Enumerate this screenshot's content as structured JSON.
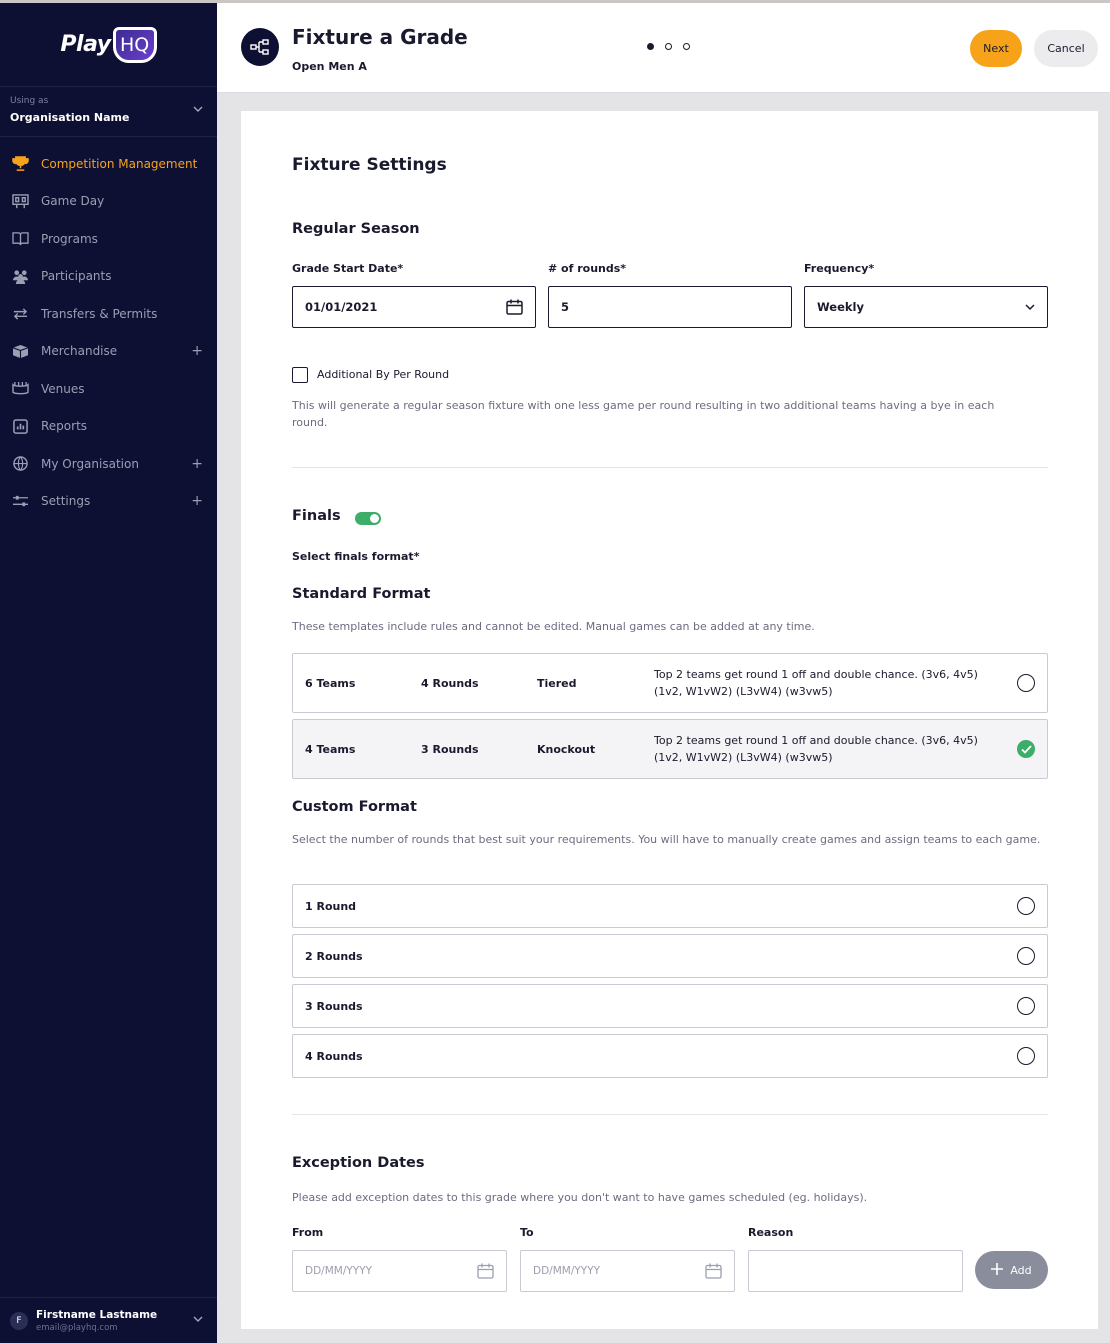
{
  "brand": {
    "logo_text": "Play",
    "logo_badge": "HQ",
    "accent": "#f6a31a",
    "sidebar_bg": "#0e1033",
    "success": "#3dae6a"
  },
  "org": {
    "label": "Using as",
    "name": "Organisation Name"
  },
  "nav": [
    {
      "label": "Competition Management",
      "icon": "trophy-icon",
      "active": true
    },
    {
      "label": "Game Day",
      "icon": "scoreboard-icon"
    },
    {
      "label": "Programs",
      "icon": "book-icon"
    },
    {
      "label": "Participants",
      "icon": "people-icon"
    },
    {
      "label": "Transfers & Permits",
      "icon": "transfer-arrows-icon"
    },
    {
      "label": "Merchandise",
      "icon": "box-icon",
      "expand": "+"
    },
    {
      "label": "Venues",
      "icon": "stadium-icon"
    },
    {
      "label": "Reports",
      "icon": "report-icon"
    },
    {
      "label": "My Organisation",
      "icon": "globe-icon",
      "expand": "+"
    },
    {
      "label": "Settings",
      "icon": "sliders-icon",
      "expand": "+"
    }
  ],
  "user": {
    "initial": "F",
    "name": "Firstname Lastname",
    "email": "email@playhq.com"
  },
  "header": {
    "title": "Fixture a Grade",
    "subtitle": "Open Men A",
    "step_current": 1,
    "step_total": 3,
    "next_label": "Next",
    "cancel_label": "Cancel"
  },
  "fixture_settings": {
    "title": "Fixture Settings"
  },
  "regular_season": {
    "title": "Regular Season",
    "start_date_label": "Grade Start Date*",
    "start_date_value": "01/01/2021",
    "rounds_label": "# of rounds*",
    "rounds_value": "5",
    "frequency_label": "Frequency*",
    "frequency_value": "Weekly",
    "bye_checkbox_label": "Additional By Per Round",
    "bye_help": "This will generate a regular season fixture with one less game per round resulting in two additional teams having a bye in each round."
  },
  "finals": {
    "title": "Finals",
    "enabled": true,
    "select_label": "Select finals format*",
    "standard_title": "Standard Format",
    "standard_help": "These templates include rules and cannot be edited. Manual games can be added at any time.",
    "standard_options": [
      {
        "teams": "6 Teams",
        "rounds": "4 Rounds",
        "type": "Tiered",
        "description": "Top 2 teams get round 1 off and double chance. (3v6, 4v5) (1v2, W1vW2) (L3vW4) (w3vw5)",
        "selected": false
      },
      {
        "teams": "4 Teams",
        "rounds": "3 Rounds",
        "type": "Knockout",
        "description": "Top 2 teams get round 1 off and double chance. (3v6, 4v5) (1v2, W1vW2) (L3vW4) (w3vw5)",
        "selected": true
      }
    ],
    "custom_title": "Custom Format",
    "custom_help": "Select the number of rounds that best suit your requirements. You will have to manually create games and assign teams to each game.",
    "custom_options": [
      "1 Round",
      "2 Rounds",
      "3 Rounds",
      "4 Rounds"
    ]
  },
  "exceptions": {
    "title": "Exception Dates",
    "help": "Please add exception dates to this grade where you don't want to have games scheduled (eg. holidays).",
    "from_label": "From",
    "from_placeholder": "DD/MM/YYYY",
    "to_label": "To",
    "to_placeholder": "DD/MM/YYYY",
    "reason_label": "Reason",
    "add_label": "Add"
  }
}
